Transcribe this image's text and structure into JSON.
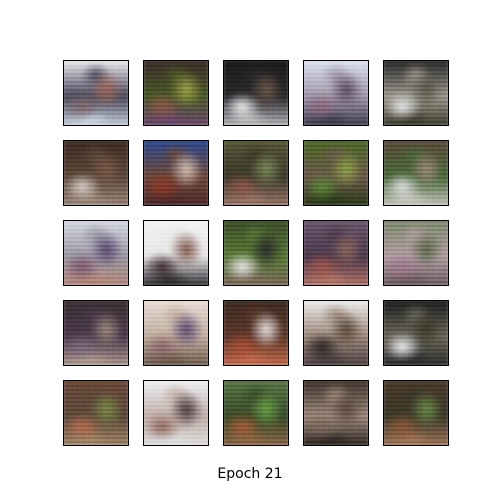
{
  "figure": {
    "caption": "Epoch 21",
    "rows": 5,
    "cols": 5,
    "tiles": [
      {
        "colors": [
          "#f2f4f6",
          "#7d6a6a",
          "#9a6a5a",
          "#4a4a55",
          "#cdd7e2"
        ]
      },
      {
        "colors": [
          "#3a2a2a",
          "#8a5a4a",
          "#9aa04a",
          "#4a5a2a",
          "#6a4a6a"
        ]
      },
      {
        "colors": [
          "#1a1a1a",
          "#f0f0f0",
          "#6a5a4a",
          "#2a2a2a",
          "#bcbcbc"
        ]
      },
      {
        "colors": [
          "#dfe7f0",
          "#8a6a7a",
          "#5a4a5a",
          "#a09aa6",
          "#3a3a4a"
        ]
      },
      {
        "colors": [
          "#222222",
          "#e8e8e8",
          "#5a5a4a",
          "#9a9a8a",
          "#3a3a2a"
        ]
      },
      {
        "colors": [
          "#3a2a22",
          "#d8cfc8",
          "#7a5a4a",
          "#5a4a3a",
          "#9a8a7a"
        ]
      },
      {
        "colors": [
          "#2a4a8a",
          "#8a3a2a",
          "#d0c0b0",
          "#6a4a3a",
          "#4a2a2a"
        ]
      },
      {
        "colors": [
          "#5a5a3a",
          "#8a5a4a",
          "#7a8a5a",
          "#3a3a2a",
          "#9a7a6a"
        ]
      },
      {
        "colors": [
          "#4a6a2a",
          "#5a8a3a",
          "#8aa04a",
          "#6a5a4a",
          "#2a3a1a"
        ]
      },
      {
        "colors": [
          "#5a4a3a",
          "#e0e0e0",
          "#9a8a7a",
          "#4a6a3a",
          "#c8c8c0"
        ]
      },
      {
        "colors": [
          "#d8dce6",
          "#7a5a6a",
          "#5a4a6a",
          "#9a9aa0",
          "#b08a7a"
        ]
      },
      {
        "colors": [
          "#f4f4f4",
          "#3a2a2a",
          "#7a5a4a",
          "#e6e6e6",
          "#2a2a2a"
        ]
      },
      {
        "colors": [
          "#3a4a2a",
          "#eaeaea",
          "#2a2a2a",
          "#5a7a3a",
          "#7a6a5a"
        ]
      },
      {
        "colors": [
          "#6a5a6a",
          "#9a5a4a",
          "#8a6a5a",
          "#4a3a4a",
          "#b07a6a"
        ]
      },
      {
        "colors": [
          "#7a8a6a",
          "#9a7a8a",
          "#5a6a4a",
          "#b0a0a0",
          "#6a5a5a"
        ]
      },
      {
        "colors": [
          "#3a3030",
          "#7a6a7a",
          "#9a8a7a",
          "#4a3a4a",
          "#b0a090"
        ]
      },
      {
        "colors": [
          "#e8e0d8",
          "#8a6a6a",
          "#5a4a6a",
          "#c0b0a0",
          "#6a5a4a"
        ]
      },
      {
        "colors": [
          "#3a2a22",
          "#a0503a",
          "#e8e4e0",
          "#5a3a2a",
          "#c07050"
        ]
      },
      {
        "colors": [
          "#f2f2f2",
          "#2a2420",
          "#5a4a3a",
          "#9a8a7a",
          "#4a4040"
        ]
      },
      {
        "colors": [
          "#1a1a1a",
          "#f2f2f2",
          "#3a3a2a",
          "#6a6a5a",
          "#2a2a2a"
        ]
      },
      {
        "colors": [
          "#6a4a3a",
          "#b07050",
          "#7a8a4a",
          "#5a4a3a",
          "#a08a6a"
        ]
      },
      {
        "colors": [
          "#f0f4f6",
          "#8a6a5a",
          "#4a3a3a",
          "#c0b0a8",
          "#e0e0e0"
        ]
      },
      {
        "colors": [
          "#5a7a4a",
          "#a0603a",
          "#6aa04a",
          "#3a4a2a",
          "#8a6a4a"
        ]
      },
      {
        "colors": [
          "#3a3028",
          "#7a6a5a",
          "#5a4a40",
          "#9a8a7a",
          "#2a2420"
        ]
      },
      {
        "colors": [
          "#4a3a2a",
          "#8a5a3a",
          "#6a8a4a",
          "#3a3a2a",
          "#a07a5a"
        ]
      }
    ]
  }
}
